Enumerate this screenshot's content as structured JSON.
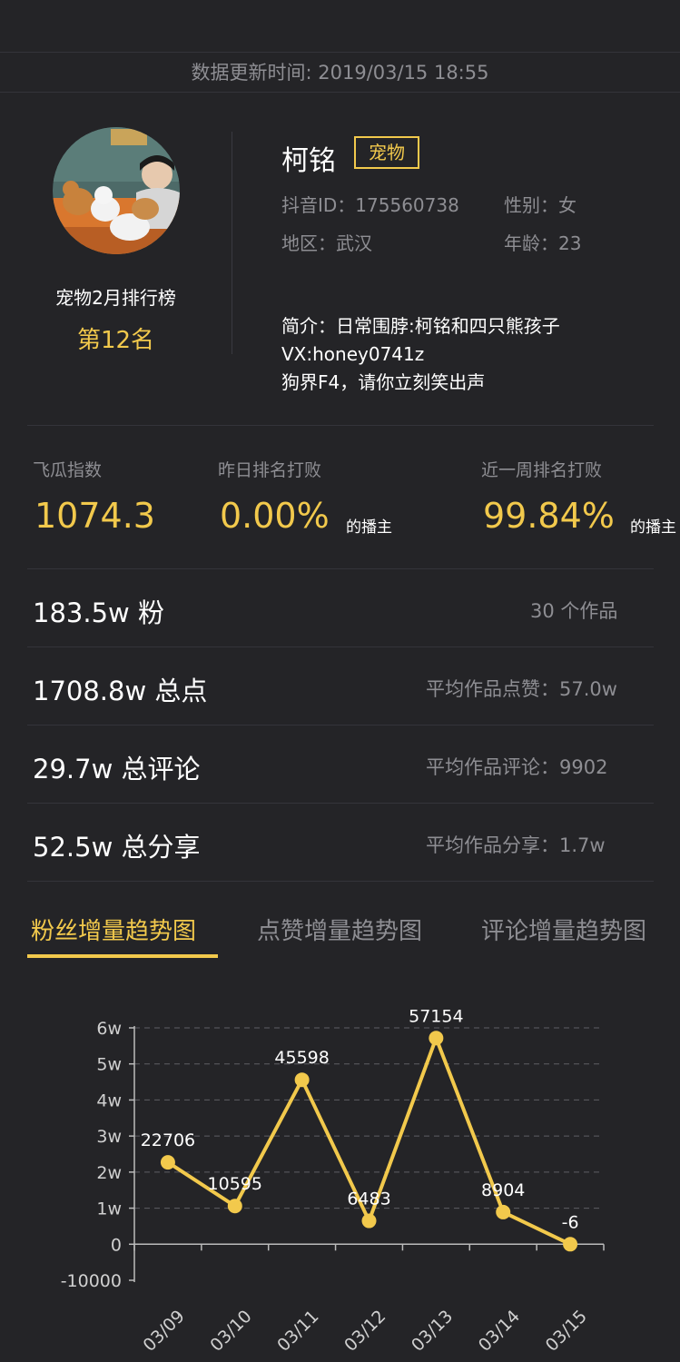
{
  "header": {
    "update_time": "数据更新时间: 2019/03/15 18:55"
  },
  "profile": {
    "name": "柯铭",
    "tag": "宠物",
    "douyin_id": "抖音ID：175560738",
    "gender": "性别：女",
    "region": "地区：武汉",
    "age": "年龄：23",
    "rank_title": "宠物2月排行榜",
    "rank": "第12名",
    "bio": [
      "简介：日常围脖:柯铭和四只熊孩子",
      "VX:honey0741z",
      "狗界F4，请你立刻笑出声"
    ]
  },
  "stats": [
    {
      "label": "飞瓜指数",
      "value": "1074.3",
      "suffix": ""
    },
    {
      "label": "昨日排名打败",
      "value": "0.00%",
      "suffix": "的播主"
    },
    {
      "label": "近一周排名打败",
      "value": "99.84%",
      "suffix": "的播主"
    }
  ],
  "rows": [
    {
      "main": "183.5w 粉",
      "side": "30 个作品"
    },
    {
      "main": "1708.8w 总点",
      "side": "平均作品点赞：57.0w"
    },
    {
      "main": "29.7w 总评论",
      "side": "平均作品评论：9902"
    },
    {
      "main": "52.5w 总分享",
      "side": "平均作品分享：1.7w"
    }
  ],
  "tabs": [
    "粉丝增量趋势图",
    "点赞增量趋势图",
    "评论增量趋势图"
  ],
  "colors": {
    "accent": "#f2c94c",
    "background": "#242427",
    "muted": "#8e8e93"
  },
  "chart_data": {
    "type": "line",
    "x": [
      "03/09",
      "03/10",
      "03/11",
      "03/12",
      "03/13",
      "03/14",
      "03/15"
    ],
    "values": [
      22706,
      10595,
      45598,
      6483,
      57154,
      8904,
      -6
    ],
    "data_labels": [
      "22706",
      "10595",
      "45598",
      "6483",
      "57154",
      "8904",
      "-6"
    ],
    "y_ticks": [
      -10000,
      0,
      10000,
      20000,
      30000,
      40000,
      50000,
      60000
    ],
    "y_tick_labels": [
      "-10000",
      "0",
      "1w",
      "2w",
      "3w",
      "4w",
      "5w",
      "6w"
    ],
    "ylim": [
      -10000,
      60000
    ],
    "grid": true
  }
}
